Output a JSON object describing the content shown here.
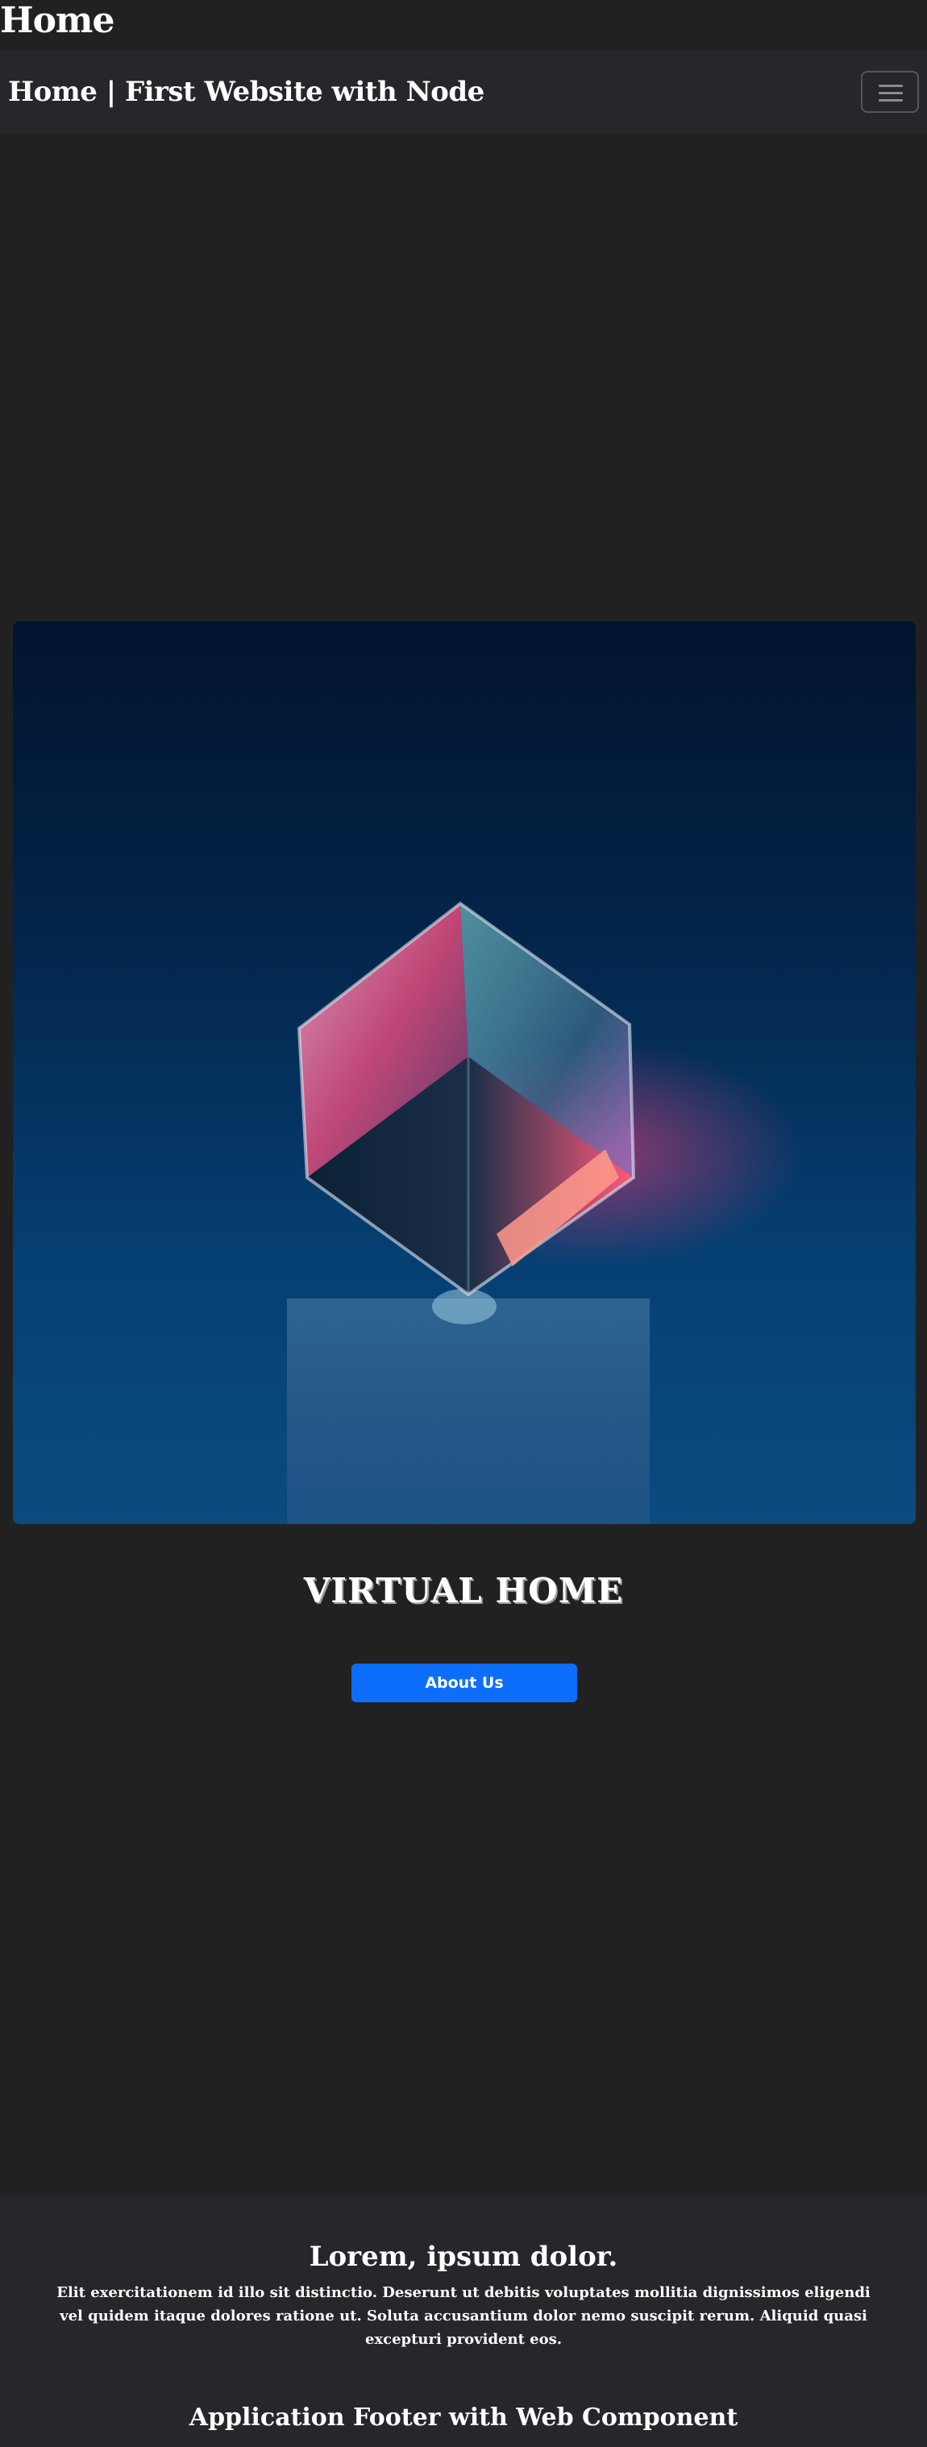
{
  "document": {
    "heading": "Home"
  },
  "navbar": {
    "brand": "Home | First Website with Node",
    "toggle_icon": "hamburger-menu-icon"
  },
  "hero": {
    "image": "glass-cube-on-blue-background",
    "title": "VIRTUAL HOME",
    "button_label": "About Us"
  },
  "footer": {
    "heading": "Lorem, ipsum dolor.",
    "text": "Elit exercitationem id illo sit distinctio. Deserunt ut debitis voluptates mollitia dignissimos eligendi vel quidem itaque dolores ratione ut. Soluta accusantium dolor nemo suscipit rerum. Aliquid quasi excepturi provident eos.",
    "component_title": "Application Footer with Web Component"
  },
  "colors": {
    "background": "#212121",
    "navbar": "#25272a",
    "primary_button": "#0d6efd",
    "text": "#ffffff"
  }
}
